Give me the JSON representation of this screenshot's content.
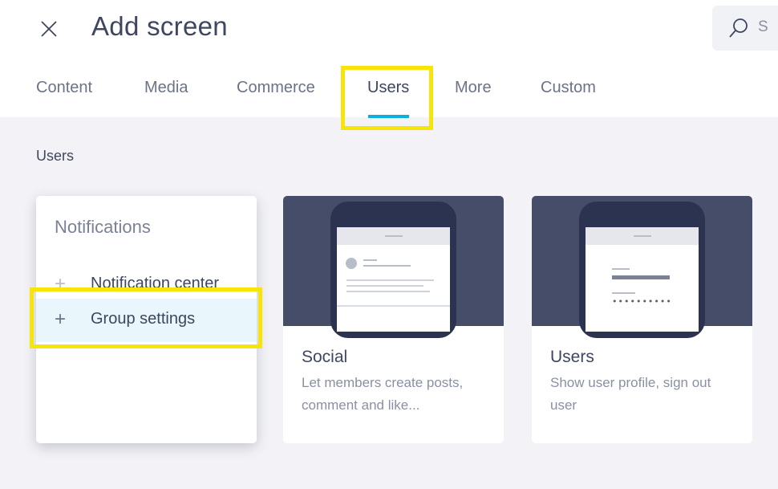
{
  "header": {
    "title": "Add screen",
    "search_placeholder": "S"
  },
  "tabs": [
    {
      "label": "Content",
      "active": false
    },
    {
      "label": "Media",
      "active": false
    },
    {
      "label": "Commerce",
      "active": false
    },
    {
      "label": "Users",
      "active": true
    },
    {
      "label": "More",
      "active": false
    },
    {
      "label": "Custom",
      "active": false
    }
  ],
  "section": {
    "label": "Users"
  },
  "notifications_card": {
    "title": "Notifications",
    "items": [
      {
        "icon": "plus-icon",
        "label": "Notification center",
        "selected": false
      },
      {
        "icon": "plus-icon",
        "label": "Group settings",
        "selected": true
      }
    ]
  },
  "screen_cards": [
    {
      "title": "Social",
      "description": "Let members create posts, comment and like..."
    },
    {
      "title": "Users",
      "description": "Show user profile, sign out user",
      "password_mask": "••••••••••"
    }
  ],
  "colors": {
    "accent": "#0bb0de",
    "highlight": "#f7e409",
    "preview_bg": "#464d68",
    "phone": "#2c3350",
    "selected_row": "#e9f6fb"
  },
  "icons": {
    "close": "close-icon",
    "search": "search-icon",
    "add": "plus-icon"
  }
}
